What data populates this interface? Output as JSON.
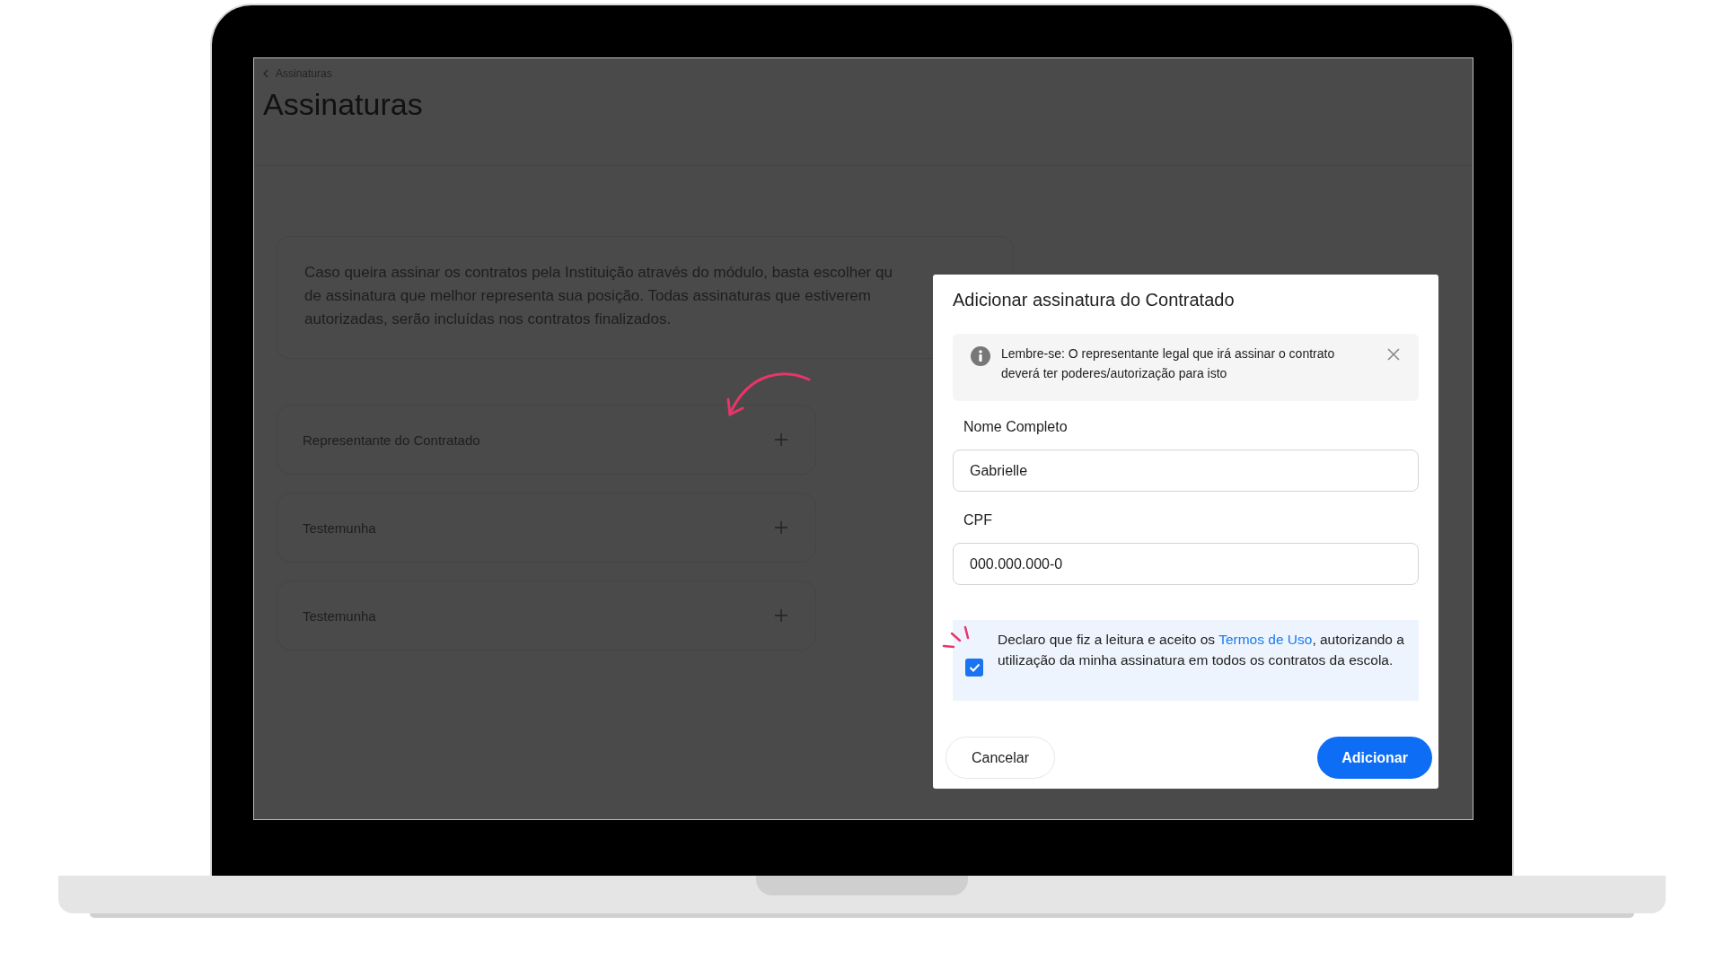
{
  "breadcrumb": {
    "label": "Assinaturas"
  },
  "page_title": "Assinaturas",
  "info_card": {
    "text": "Caso queira assinar os contratos pela Instituição através do módulo, basta escolher qu\nde assinatura que melhor representa sua posição. Todas assinaturas que estiverem\nautorizadas, serão incluídas nos contratos finalizados."
  },
  "signature_rows": [
    {
      "label": "Representante do Contratado"
    },
    {
      "label": "Testemunha"
    },
    {
      "label": "Testemunha"
    }
  ],
  "dialog": {
    "title": "Adicionar assinatura do Contratado",
    "alert": {
      "text": "Lembre-se: O representante legal que irá assinar o contrato deverá ter poderes/autorização para isto"
    },
    "fields": [
      {
        "label": "Nome Completo",
        "value": "Gabrielle"
      },
      {
        "label": "CPF",
        "value": "000.000.000-0"
      }
    ],
    "consent": {
      "checked": true,
      "text_before": "Declaro que fiz a leitura e aceito os ",
      "link": "Termos de Uso",
      "text_after": ", autorizando a utilização da minha assinatura em todos os contratos da escola."
    },
    "buttons": [
      {
        "label": "Cancelar",
        "kind": "secondary"
      },
      {
        "label": "Adicionar",
        "kind": "primary"
      }
    ]
  }
}
